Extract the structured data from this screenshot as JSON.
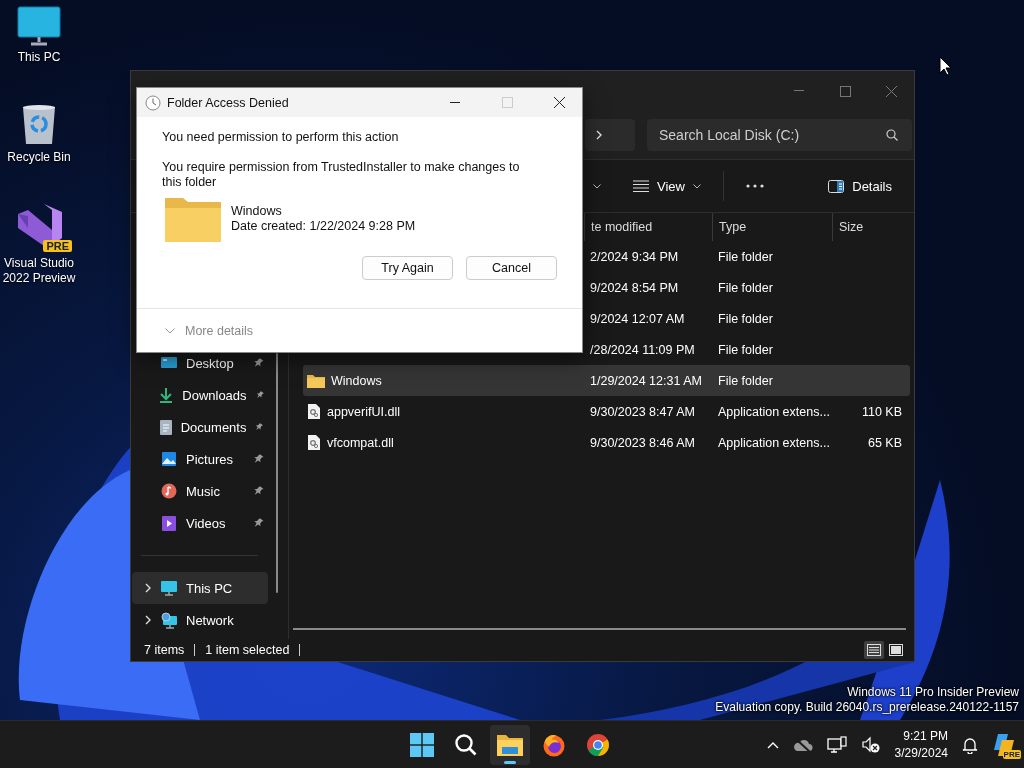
{
  "desktop_icons": [
    {
      "label": "This PC",
      "kind": "pc"
    },
    {
      "label": "Recycle Bin",
      "kind": "bin"
    },
    {
      "label": "Visual Studio 2022 Preview",
      "kind": "vs",
      "badge": "PRE"
    }
  ],
  "explorer": {
    "search": {
      "placeholder": "Search Local Disk (C:)"
    },
    "toolbar": [
      {
        "kind": "caret"
      },
      {
        "kind": "menu",
        "label": "View"
      },
      {
        "kind": "more"
      },
      {
        "kind": "toggle",
        "label": "Details"
      }
    ],
    "nav": [
      {
        "label": "Desktop",
        "kind": "desktop",
        "pinned": true,
        "expandable": false,
        "selected": false
      },
      {
        "label": "Downloads",
        "kind": "downloads",
        "pinned": true,
        "expandable": false,
        "selected": false
      },
      {
        "label": "Documents",
        "kind": "documents",
        "pinned": true,
        "expandable": false,
        "selected": false
      },
      {
        "label": "Pictures",
        "kind": "pictures",
        "pinned": true,
        "expandable": false,
        "selected": false
      },
      {
        "label": "Music",
        "kind": "music",
        "pinned": true,
        "expandable": false,
        "selected": false
      },
      {
        "label": "Videos",
        "kind": "videos",
        "pinned": true,
        "expandable": false,
        "selected": false
      },
      {
        "label": "This PC",
        "kind": "pc",
        "pinned": false,
        "expandable": true,
        "selected": true
      },
      {
        "label": "Network",
        "kind": "network",
        "pinned": false,
        "expandable": true,
        "selected": false
      }
    ],
    "columns": [
      "te modified",
      "Type",
      "Size"
    ],
    "rows": [
      {
        "kind": "hidden",
        "modified": "2/2024 9:34 PM",
        "type": "File folder",
        "selected": false
      },
      {
        "kind": "hidden",
        "modified": "9/2024 8:54 PM",
        "type": "File folder",
        "selected": false
      },
      {
        "kind": "hidden",
        "modified": "9/2024 12:07 AM",
        "type": "File folder",
        "selected": false
      },
      {
        "kind": "hidden",
        "modified": "/28/2024 11:09 PM",
        "type": "File folder",
        "selected": false
      },
      {
        "kind": "folder",
        "name": "Windows",
        "modified": "1/29/2024 12:31 AM",
        "type": "File folder",
        "selected": true
      },
      {
        "kind": "dll",
        "name": "appverifUI.dll",
        "modified": "9/30/2023 8:47 AM",
        "type": "Application extens...",
        "size": "110 KB",
        "selected": false
      },
      {
        "kind": "dll",
        "name": "vfcompat.dll",
        "modified": "9/30/2023 8:46 AM",
        "type": "Application extens...",
        "size": "65 KB",
        "selected": false
      }
    ],
    "status": {
      "count": "7 items",
      "selection": "1 item selected"
    },
    "views": [
      {
        "kind": "details",
        "selected": true
      },
      {
        "kind": "tiles",
        "selected": false
      }
    ]
  },
  "dialog": {
    "title": "Folder Access Denied",
    "maximize_disabled": true,
    "heading": "You need permission to perform this action",
    "message": "You require permission from TrustedInstaller to make changes to this folder",
    "item": {
      "name": "Windows",
      "date": "Date created: 1/22/2024 9:28 PM"
    },
    "buttons": [
      "Try Again",
      "Cancel"
    ],
    "more_details": "More details"
  },
  "edition_notice": [
    "Windows 11 Pro Insider Preview",
    "Evaluation copy. Build 26040.rs_prerelease.240122-1157"
  ],
  "taskbar": {
    "apps": [
      {
        "kind": "start",
        "active": false
      },
      {
        "kind": "search",
        "active": false
      },
      {
        "kind": "explorer",
        "active": true
      },
      {
        "kind": "firefox",
        "active": false
      },
      {
        "kind": "chrome",
        "active": false
      }
    ],
    "time": "9:21 PM",
    "date": "3/29/2024",
    "copilot_badge": "PRE"
  }
}
